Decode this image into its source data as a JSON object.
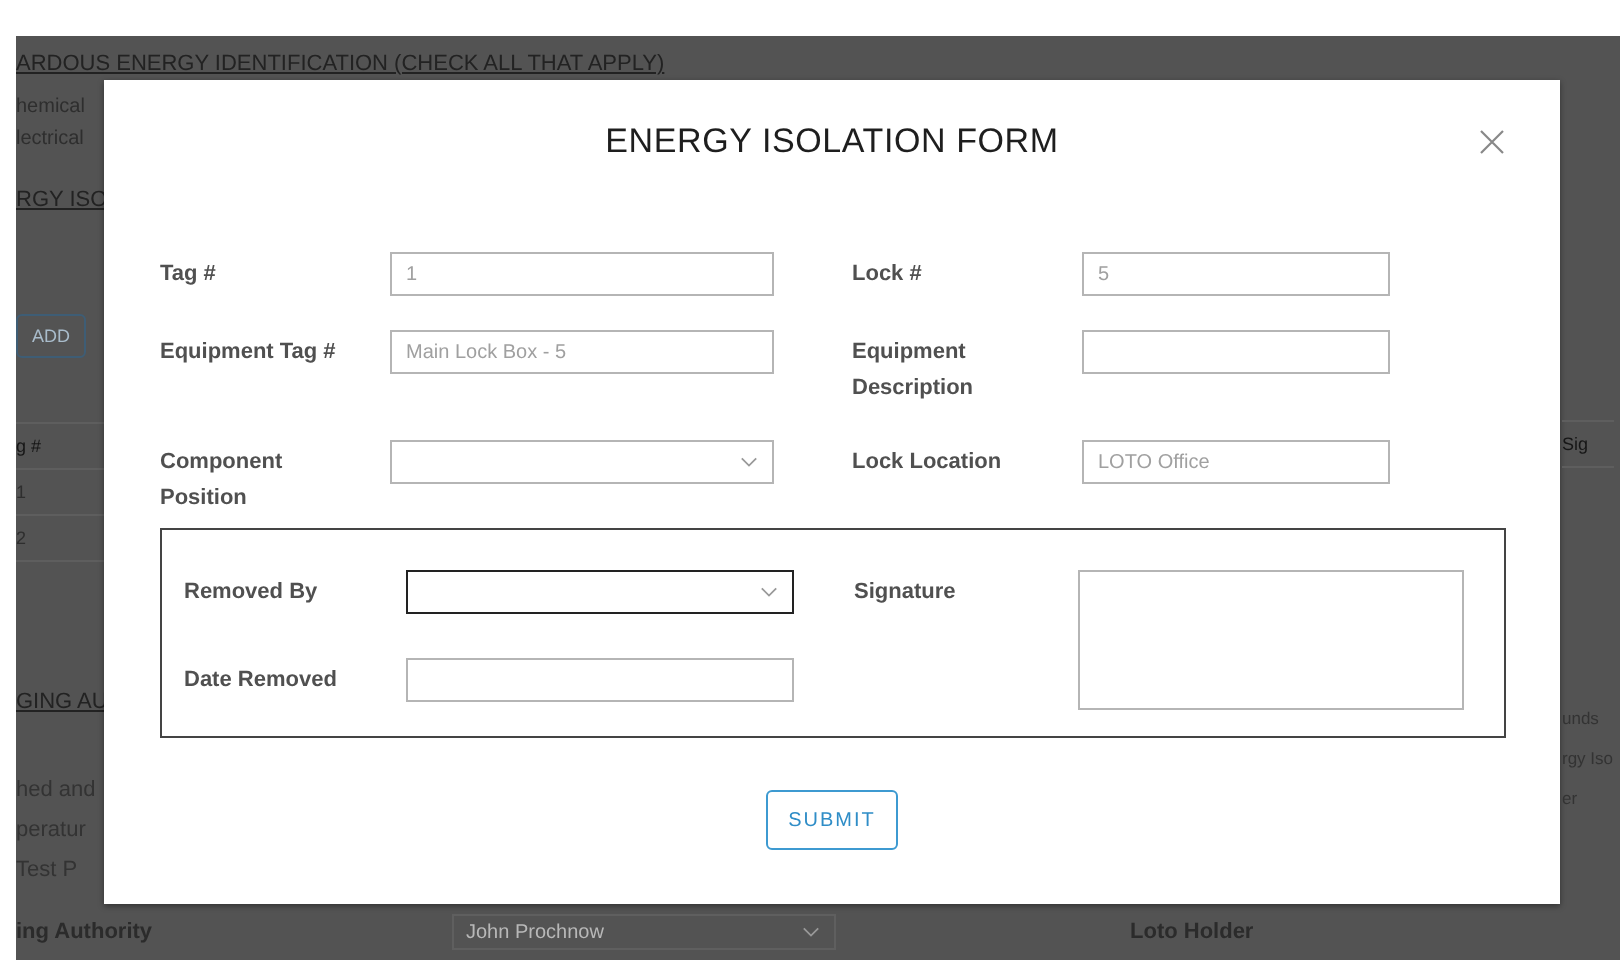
{
  "background": {
    "heading": "ARDOUS ENERGY IDENTIFICATION (CHECK ALL THAT APPLY)",
    "left": {
      "checkbox_labels": [
        "hemical",
        "lectrical"
      ],
      "section_heading": "RGY ISO",
      "add_button": "ADD",
      "table": {
        "header": "g #",
        "rows": [
          "1",
          "2"
        ]
      },
      "section_heading_2": "GING AU",
      "paragraph_lines": [
        "hed and",
        "peratur",
        "Test P"
      ]
    },
    "right": {
      "table_header": "Sig",
      "paragraph_lines": [
        "unds",
        "rgy Iso",
        "er"
      ]
    },
    "bottom": {
      "label": "ing Authority",
      "select_value": "John Prochnow",
      "label_2": "Loto Holder"
    }
  },
  "modal": {
    "title": "ENERGY ISOLATION FORM",
    "fields": [
      {
        "label": "Tag #",
        "kind": "text",
        "value": "1"
      },
      {
        "label": "Lock #",
        "kind": "text",
        "value": "5"
      },
      {
        "label": "Equipment Tag #",
        "kind": "text",
        "value": "Main Lock Box - 5"
      },
      {
        "label": "Equipment Description",
        "kind": "text"
      },
      {
        "label": "Component Position",
        "kind": "select"
      },
      {
        "label": "Lock Location",
        "kind": "text",
        "value": "LOTO Office"
      }
    ],
    "removal": {
      "fields": [
        {
          "label": "Removed By",
          "kind": "select",
          "focused": true
        },
        {
          "label": "Date Removed",
          "kind": "text",
          "focused": false
        }
      ],
      "signature": {
        "label": "Signature"
      }
    },
    "submit": "SUBMIT"
  }
}
